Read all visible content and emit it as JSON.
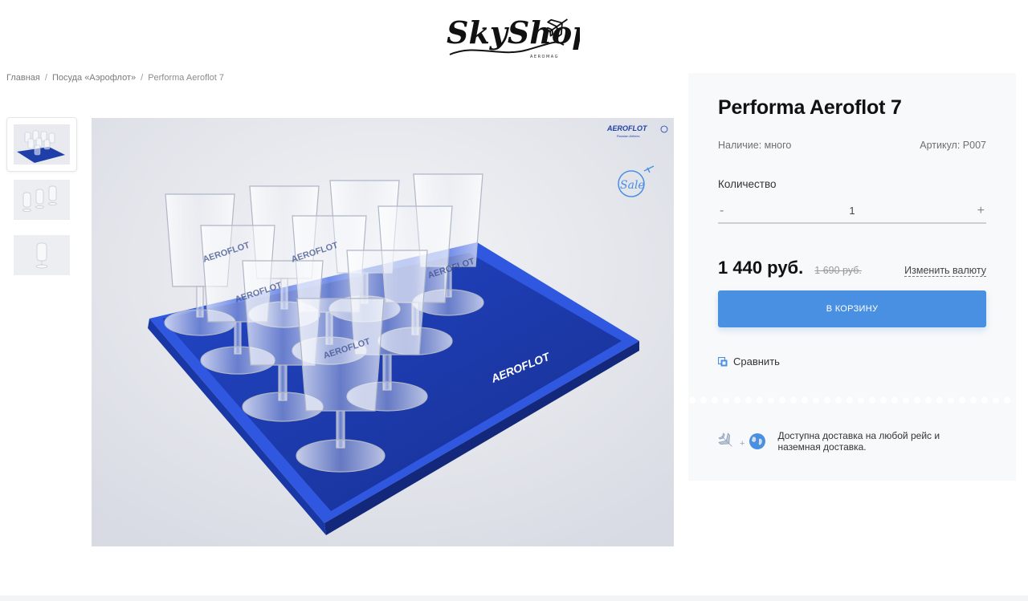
{
  "header": {
    "logo_text": "SkyShop",
    "logo_subtext": "AEROMAG"
  },
  "breadcrumb": {
    "items": [
      "Главная",
      "Посуда «Аэрофлот»"
    ],
    "current": "Performa Aeroflot 7",
    "separator": "/"
  },
  "gallery": {
    "thumbnails": [
      "glasses-on-tray",
      "glasses-row",
      "single-glass"
    ],
    "active_index": 0,
    "photo_labels": {
      "brand": "AEROFLOT",
      "brand_sub": "Russian Airlines",
      "sale_badge": "Sale"
    }
  },
  "product": {
    "title": "Performa Aeroflot 7",
    "availability": "Наличие: много",
    "sku": "Артикул: P007",
    "quantity_label": "Количество",
    "quantity_value": "1",
    "minus": "-",
    "plus": "+",
    "price": "1 440 руб.",
    "old_price": "1 690 руб.",
    "change_currency": "Изменить валюту",
    "add_to_cart": "В КОРЗИНУ",
    "compare": "Сравнить",
    "delivery_plus": "+",
    "delivery_text": "Доступна доставка на любой рейс и наземная доставка."
  },
  "colors": {
    "accent": "#4a90e2",
    "panel_bg": "#f8f9fa",
    "tray_blue": "#1f3fa8"
  },
  "icons": [
    "airplane-logo-icon",
    "compare-icon",
    "plane-icon",
    "globe-icon"
  ]
}
